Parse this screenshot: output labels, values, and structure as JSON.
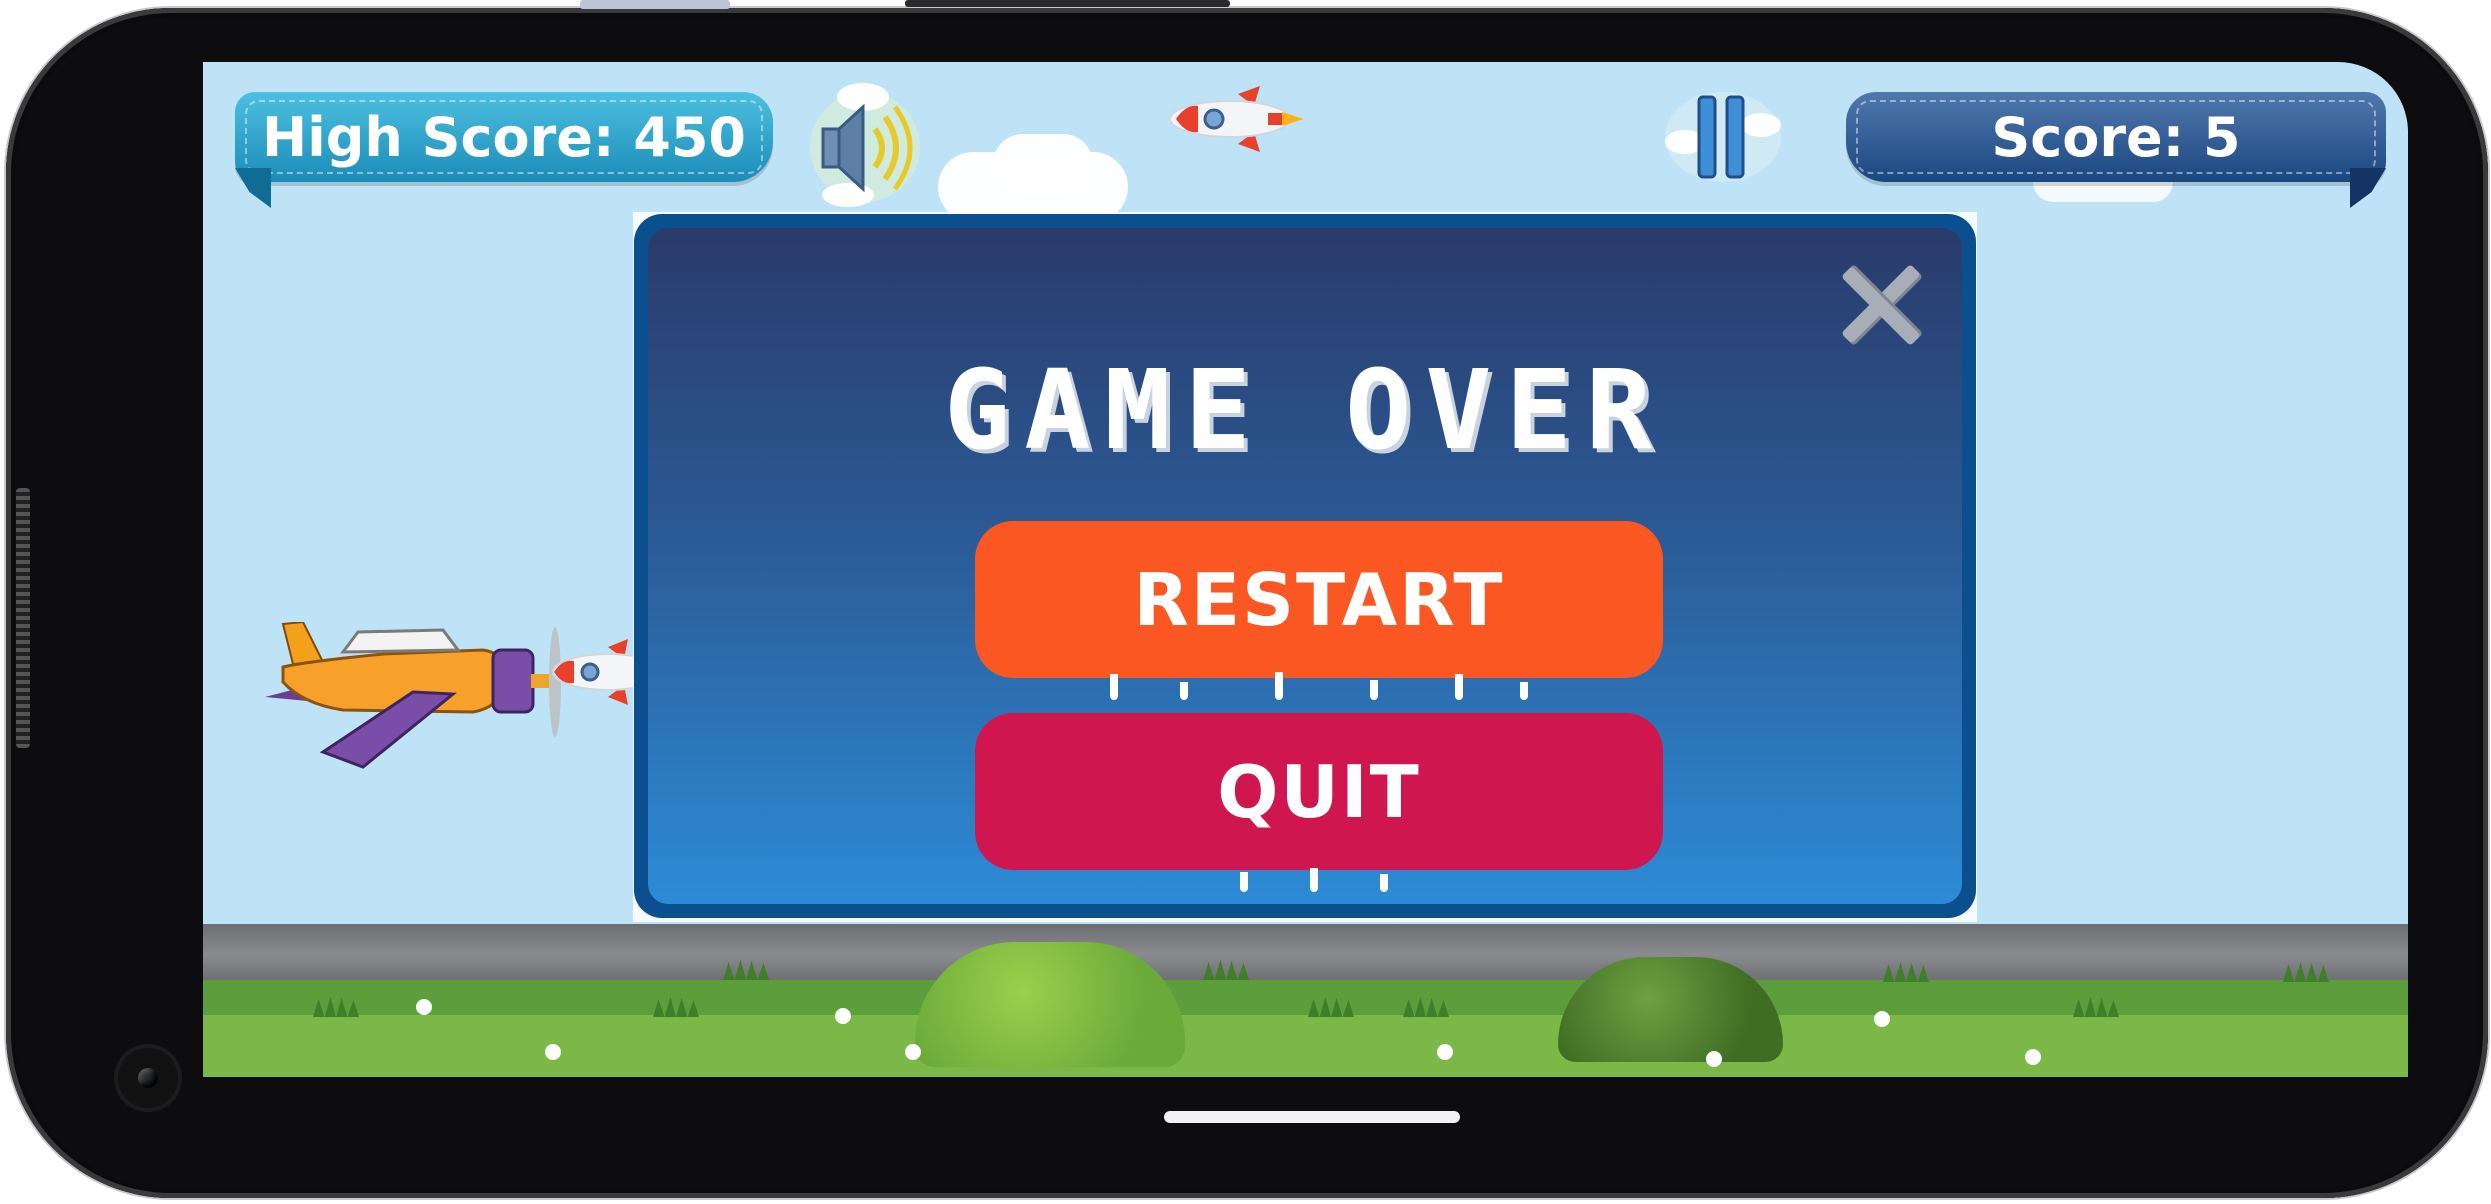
{
  "hud": {
    "high_score_label": "High Score: 450",
    "score_label": "Score: 5",
    "sound_icon": "speaker-on-icon",
    "pause_icon": "pause-icon"
  },
  "dialog": {
    "title": "GAME OVER",
    "restart_label": "RESTART",
    "quit_label": "QUIT",
    "close_icon": "close-x-icon"
  },
  "colors": {
    "sky": "#bfe3f6",
    "restart": "#fb5722",
    "quit": "#d0164f",
    "dialog_border": "#0b4f8e",
    "high_score_banner": "#2aa5d0",
    "score_banner": "#2d5a96"
  }
}
